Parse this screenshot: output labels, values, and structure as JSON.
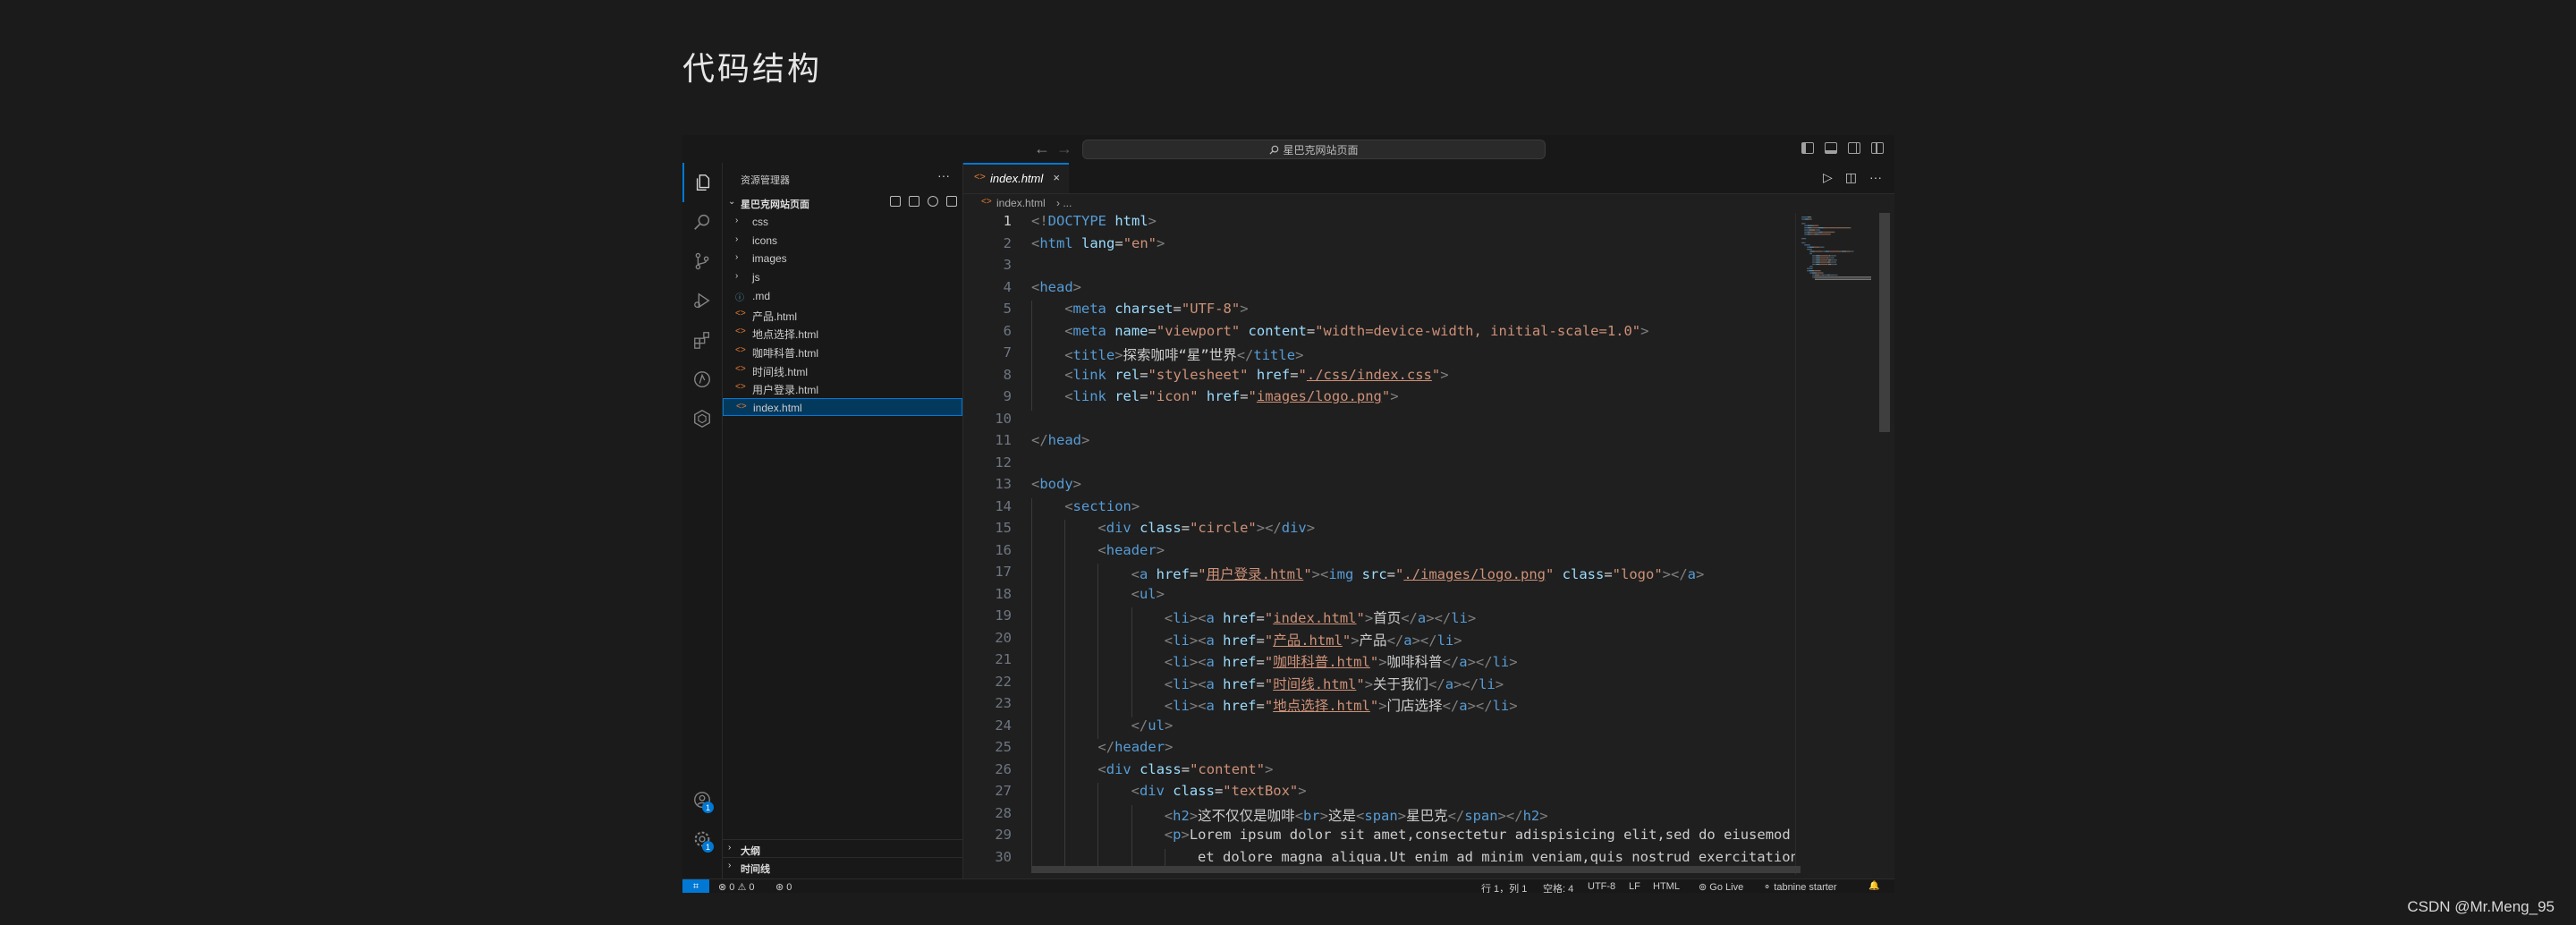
{
  "page": {
    "heading": "代码结构",
    "watermark": "CSDN @Mr.Meng_95"
  },
  "titlebar": {
    "search_text": "星巴克网站页面",
    "back_icon": "←",
    "forward_icon": "→"
  },
  "activity_bar": {
    "top": [
      "files-icon",
      "search-icon",
      "source-control-icon",
      "run-debug-icon",
      "extensions-icon",
      "remote-explorer-icon",
      "hexagon-icon"
    ],
    "bottom_badges": {
      "account": "1",
      "settings": "1"
    }
  },
  "sidebar": {
    "title": "资源管理器",
    "more": "···",
    "folder": "星巴克网站页面",
    "items": [
      {
        "icon": "›",
        "label": "css",
        "kind": "folder"
      },
      {
        "icon": "›",
        "label": "icons",
        "kind": "folder"
      },
      {
        "icon": "›",
        "label": "images",
        "kind": "folder"
      },
      {
        "icon": "›",
        "label": "js",
        "kind": "folder"
      },
      {
        "icon": "ⓘ",
        "label": ".md",
        "kind": "md"
      },
      {
        "icon": "<>",
        "label": "产品.html",
        "kind": "html"
      },
      {
        "icon": "<>",
        "label": "地点选择.html",
        "kind": "html"
      },
      {
        "icon": "<>",
        "label": "咖啡科普.html",
        "kind": "html"
      },
      {
        "icon": "<>",
        "label": "时间线.html",
        "kind": "html"
      },
      {
        "icon": "<>",
        "label": "用户登录.html",
        "kind": "html"
      },
      {
        "icon": "<>",
        "label": "index.html",
        "kind": "html"
      }
    ],
    "sections": [
      "大纲",
      "时间线"
    ]
  },
  "editor": {
    "tab_icon": "<>",
    "tab_label": "index.html",
    "tab_close": "×",
    "breadcrumb_file": "index.html",
    "breadcrumb_rest": "› ...",
    "actions": [
      "▷",
      "◫",
      "···"
    ],
    "lines": [
      {
        "n": "1",
        "indent": 0,
        "tokens": [
          [
            "b",
            "<!"
          ],
          [
            "t",
            "DOCTYPE"
          ],
          [
            "a",
            " html"
          ],
          [
            "b",
            ">"
          ]
        ]
      },
      {
        "n": "2",
        "indent": 0,
        "tokens": [
          [
            "b",
            "<"
          ],
          [
            "t",
            "html"
          ],
          [
            "a",
            " lang"
          ],
          [
            "p",
            "="
          ],
          [
            "s",
            "\"en\""
          ],
          [
            "b",
            ">"
          ]
        ]
      },
      {
        "n": "3",
        "indent": 0,
        "tokens": []
      },
      {
        "n": "4",
        "indent": 0,
        "tokens": [
          [
            "b",
            "<"
          ],
          [
            "t",
            "head"
          ],
          [
            "b",
            ">"
          ]
        ]
      },
      {
        "n": "5",
        "indent": 1,
        "tokens": [
          [
            "b",
            "<"
          ],
          [
            "t",
            "meta"
          ],
          [
            "a",
            " charset"
          ],
          [
            "p",
            "="
          ],
          [
            "s",
            "\"UTF-8\""
          ],
          [
            "b",
            ">"
          ]
        ]
      },
      {
        "n": "6",
        "indent": 1,
        "tokens": [
          [
            "b",
            "<"
          ],
          [
            "t",
            "meta"
          ],
          [
            "a",
            " name"
          ],
          [
            "p",
            "="
          ],
          [
            "s",
            "\"viewport\""
          ],
          [
            "a",
            " content"
          ],
          [
            "p",
            "="
          ],
          [
            "s",
            "\"width=device-width, initial-scale=1.0\""
          ],
          [
            "b",
            ">"
          ]
        ]
      },
      {
        "n": "7",
        "indent": 1,
        "tokens": [
          [
            "b",
            "<"
          ],
          [
            "t",
            "title"
          ],
          [
            "b",
            ">"
          ],
          [
            "p",
            "探索咖啡“星”世界"
          ],
          [
            "b",
            "</"
          ],
          [
            "t",
            "title"
          ],
          [
            "b",
            ">"
          ]
        ]
      },
      {
        "n": "8",
        "indent": 1,
        "tokens": [
          [
            "b",
            "<"
          ],
          [
            "t",
            "link"
          ],
          [
            "a",
            " rel"
          ],
          [
            "p",
            "="
          ],
          [
            "s",
            "\"stylesheet\""
          ],
          [
            "a",
            " href"
          ],
          [
            "p",
            "="
          ],
          [
            "s",
            "\""
          ],
          [
            "su",
            "./css/index.css"
          ],
          [
            "s",
            "\""
          ],
          [
            "b",
            ">"
          ]
        ]
      },
      {
        "n": "9",
        "indent": 1,
        "tokens": [
          [
            "b",
            "<"
          ],
          [
            "t",
            "link"
          ],
          [
            "a",
            " rel"
          ],
          [
            "p",
            "="
          ],
          [
            "s",
            "\"icon\""
          ],
          [
            "a",
            " href"
          ],
          [
            "p",
            "="
          ],
          [
            "s",
            "\""
          ],
          [
            "su",
            "images/logo.png"
          ],
          [
            "s",
            "\""
          ],
          [
            "b",
            ">"
          ]
        ]
      },
      {
        "n": "10",
        "indent": 0,
        "tokens": []
      },
      {
        "n": "11",
        "indent": 0,
        "tokens": [
          [
            "b",
            "</"
          ],
          [
            "t",
            "head"
          ],
          [
            "b",
            ">"
          ]
        ]
      },
      {
        "n": "12",
        "indent": 0,
        "tokens": []
      },
      {
        "n": "13",
        "indent": 0,
        "tokens": [
          [
            "b",
            "<"
          ],
          [
            "t",
            "body"
          ],
          [
            "b",
            ">"
          ]
        ]
      },
      {
        "n": "14",
        "indent": 1,
        "tokens": [
          [
            "b",
            "<"
          ],
          [
            "t",
            "section"
          ],
          [
            "b",
            ">"
          ]
        ]
      },
      {
        "n": "15",
        "indent": 2,
        "tokens": [
          [
            "b",
            "<"
          ],
          [
            "t",
            "div"
          ],
          [
            "a",
            " class"
          ],
          [
            "p",
            "="
          ],
          [
            "s",
            "\"circle\""
          ],
          [
            "b",
            "></"
          ],
          [
            "t",
            "div"
          ],
          [
            "b",
            ">"
          ]
        ]
      },
      {
        "n": "16",
        "indent": 2,
        "tokens": [
          [
            "b",
            "<"
          ],
          [
            "t",
            "header"
          ],
          [
            "b",
            ">"
          ]
        ]
      },
      {
        "n": "17",
        "indent": 3,
        "tokens": [
          [
            "b",
            "<"
          ],
          [
            "t",
            "a"
          ],
          [
            "a",
            " href"
          ],
          [
            "p",
            "="
          ],
          [
            "s",
            "\""
          ],
          [
            "su",
            "用户登录.html"
          ],
          [
            "s",
            "\""
          ],
          [
            "b",
            "><"
          ],
          [
            "t",
            "img"
          ],
          [
            "a",
            " src"
          ],
          [
            "p",
            "="
          ],
          [
            "s",
            "\""
          ],
          [
            "su",
            "./images/logo.png"
          ],
          [
            "s",
            "\""
          ],
          [
            "a",
            " class"
          ],
          [
            "p",
            "="
          ],
          [
            "s",
            "\"logo\""
          ],
          [
            "b",
            "></"
          ],
          [
            "t",
            "a"
          ],
          [
            "b",
            ">"
          ]
        ]
      },
      {
        "n": "18",
        "indent": 3,
        "tokens": [
          [
            "b",
            "<"
          ],
          [
            "t",
            "ul"
          ],
          [
            "b",
            ">"
          ]
        ]
      },
      {
        "n": "19",
        "indent": 4,
        "tokens": [
          [
            "b",
            "<"
          ],
          [
            "t",
            "li"
          ],
          [
            "b",
            "><"
          ],
          [
            "t",
            "a"
          ],
          [
            "a",
            " href"
          ],
          [
            "p",
            "="
          ],
          [
            "s",
            "\""
          ],
          [
            "su",
            "index.html"
          ],
          [
            "s",
            "\""
          ],
          [
            "b",
            ">"
          ],
          [
            "p",
            "首页"
          ],
          [
            "b",
            "</"
          ],
          [
            "t",
            "a"
          ],
          [
            "b",
            "></"
          ],
          [
            "t",
            "li"
          ],
          [
            "b",
            ">"
          ]
        ]
      },
      {
        "n": "20",
        "indent": 4,
        "tokens": [
          [
            "b",
            "<"
          ],
          [
            "t",
            "li"
          ],
          [
            "b",
            "><"
          ],
          [
            "t",
            "a"
          ],
          [
            "a",
            " href"
          ],
          [
            "p",
            "="
          ],
          [
            "s",
            "\""
          ],
          [
            "su",
            "产品.html"
          ],
          [
            "s",
            "\""
          ],
          [
            "b",
            ">"
          ],
          [
            "p",
            "产品"
          ],
          [
            "b",
            "</"
          ],
          [
            "t",
            "a"
          ],
          [
            "b",
            "></"
          ],
          [
            "t",
            "li"
          ],
          [
            "b",
            ">"
          ]
        ]
      },
      {
        "n": "21",
        "indent": 4,
        "tokens": [
          [
            "b",
            "<"
          ],
          [
            "t",
            "li"
          ],
          [
            "b",
            "><"
          ],
          [
            "t",
            "a"
          ],
          [
            "a",
            " href"
          ],
          [
            "p",
            "="
          ],
          [
            "s",
            "\""
          ],
          [
            "su",
            "咖啡科普.html"
          ],
          [
            "s",
            "\""
          ],
          [
            "b",
            ">"
          ],
          [
            "p",
            "咖啡科普"
          ],
          [
            "b",
            "</"
          ],
          [
            "t",
            "a"
          ],
          [
            "b",
            "></"
          ],
          [
            "t",
            "li"
          ],
          [
            "b",
            ">"
          ]
        ]
      },
      {
        "n": "22",
        "indent": 4,
        "tokens": [
          [
            "b",
            "<"
          ],
          [
            "t",
            "li"
          ],
          [
            "b",
            "><"
          ],
          [
            "t",
            "a"
          ],
          [
            "a",
            " href"
          ],
          [
            "p",
            "="
          ],
          [
            "s",
            "\""
          ],
          [
            "su",
            "时间线.html"
          ],
          [
            "s",
            "\""
          ],
          [
            "b",
            ">"
          ],
          [
            "p",
            "关于我们"
          ],
          [
            "b",
            "</"
          ],
          [
            "t",
            "a"
          ],
          [
            "b",
            "></"
          ],
          [
            "t",
            "li"
          ],
          [
            "b",
            ">"
          ]
        ]
      },
      {
        "n": "23",
        "indent": 4,
        "tokens": [
          [
            "b",
            "<"
          ],
          [
            "t",
            "li"
          ],
          [
            "b",
            "><"
          ],
          [
            "t",
            "a"
          ],
          [
            "a",
            " href"
          ],
          [
            "p",
            "="
          ],
          [
            "s",
            "\""
          ],
          [
            "su",
            "地点选择.html"
          ],
          [
            "s",
            "\""
          ],
          [
            "b",
            ">"
          ],
          [
            "p",
            "门店选择"
          ],
          [
            "b",
            "</"
          ],
          [
            "t",
            "a"
          ],
          [
            "b",
            "></"
          ],
          [
            "t",
            "li"
          ],
          [
            "b",
            ">"
          ]
        ]
      },
      {
        "n": "24",
        "indent": 3,
        "tokens": [
          [
            "b",
            "</"
          ],
          [
            "t",
            "ul"
          ],
          [
            "b",
            ">"
          ]
        ]
      },
      {
        "n": "25",
        "indent": 2,
        "tokens": [
          [
            "b",
            "</"
          ],
          [
            "t",
            "header"
          ],
          [
            "b",
            ">"
          ]
        ]
      },
      {
        "n": "26",
        "indent": 2,
        "tokens": [
          [
            "b",
            "<"
          ],
          [
            "t",
            "div"
          ],
          [
            "a",
            " class"
          ],
          [
            "p",
            "="
          ],
          [
            "s",
            "\"content\""
          ],
          [
            "b",
            ">"
          ]
        ]
      },
      {
        "n": "27",
        "indent": 3,
        "tokens": [
          [
            "b",
            "<"
          ],
          [
            "t",
            "div"
          ],
          [
            "a",
            " class"
          ],
          [
            "p",
            "="
          ],
          [
            "s",
            "\"textBox\""
          ],
          [
            "b",
            ">"
          ]
        ]
      },
      {
        "n": "28",
        "indent": 4,
        "tokens": [
          [
            "b",
            "<"
          ],
          [
            "t",
            "h2"
          ],
          [
            "b",
            ">"
          ],
          [
            "p",
            "这不仅仅是咖啡"
          ],
          [
            "b",
            "<"
          ],
          [
            "t",
            "br"
          ],
          [
            "b",
            ">"
          ],
          [
            "p",
            "这是"
          ],
          [
            "b",
            "<"
          ],
          [
            "t",
            "span"
          ],
          [
            "b",
            ">"
          ],
          [
            "p",
            "星巴克"
          ],
          [
            "b",
            "</"
          ],
          [
            "t",
            "span"
          ],
          [
            "b",
            "></"
          ],
          [
            "t",
            "h2"
          ],
          [
            "b",
            ">"
          ]
        ]
      },
      {
        "n": "29",
        "indent": 4,
        "tokens": [
          [
            "b",
            "<"
          ],
          [
            "t",
            "p"
          ],
          [
            "b",
            ">"
          ],
          [
            "p",
            "Lorem ipsum dolor sit amet,consectetur adispisicing elit,sed do eiusemod tempor incididunt ut labore"
          ]
        ]
      },
      {
        "n": "30",
        "indent": 5,
        "tokens": [
          [
            "p",
            "et dolore magna aliqua.Ut enim ad minim veniam,quis nostrud exercitation ullamco laboris nisi ut aliquip ex ea commodo"
          ]
        ]
      }
    ]
  },
  "statusbar": {
    "remote": "⌗",
    "problems": "⊗ 0 ⚠ 0",
    "ports": "⊛ 0",
    "position": "行 1，列 1",
    "spaces": "空格: 4",
    "encoding": "UTF-8",
    "eol": "LF",
    "language": "HTML",
    "golive": "⊚ Go Live",
    "tabnine": "⚬ tabnine starter",
    "bell": "🔔"
  }
}
